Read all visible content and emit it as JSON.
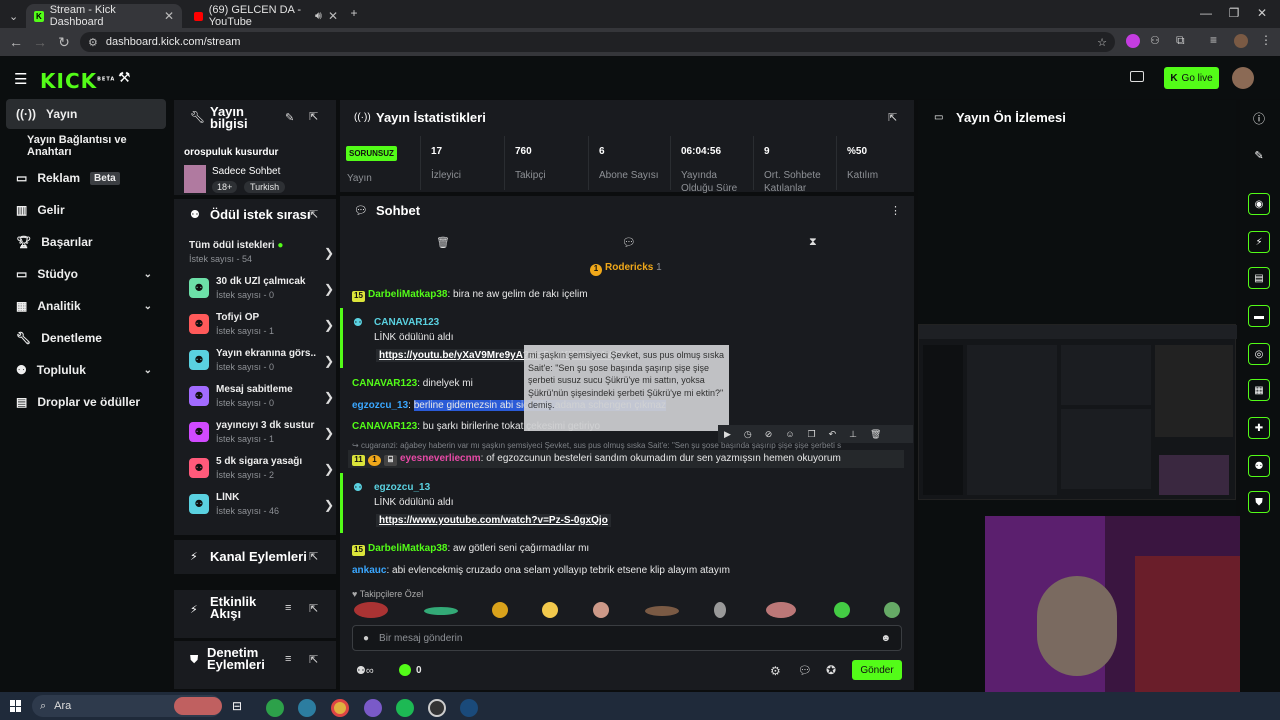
{
  "browser": {
    "tabs": [
      {
        "title": "Stream - Kick Dashboard"
      },
      {
        "title": "(69) GELCEN DA - YouTube"
      }
    ],
    "url": "dashboard.kick.com/stream"
  },
  "header": {
    "logo": "KICK",
    "logo_sup": "BETA",
    "go_live": "Go live"
  },
  "nav": {
    "items": [
      {
        "label": "Yayın"
      },
      {
        "label": "Yayın Bağlantısı ve Anahtarı"
      },
      {
        "label": "Reklam",
        "badge": "Beta"
      },
      {
        "label": "Gelir"
      },
      {
        "label": "Başarılar"
      },
      {
        "label": "Stüdyo"
      },
      {
        "label": "Analitik"
      },
      {
        "label": "Denetleme"
      },
      {
        "label": "Topluluk"
      },
      {
        "label": "Droplar ve ödüller"
      }
    ]
  },
  "stream_info": {
    "title": "Yayın bilgisi",
    "stream_title": "orospuluk kusurdur",
    "category": "Sadece Sohbet",
    "tags": [
      "18+",
      "Turkish"
    ]
  },
  "rewards": {
    "title": "Ödül istek sırası",
    "all": "Tüm ödül istekleri",
    "all_sub": "İstek sayısı - 54",
    "items": [
      {
        "title": "30 dk UZİ çalmıcak",
        "sub": "İstek sayısı - 0",
        "color": "#6de0a8"
      },
      {
        "title": "Tofiyi ÖP",
        "sub": "İstek sayısı - 1",
        "color": "#ff5a5a"
      },
      {
        "title": "Yayın ekranına görs...",
        "sub": "İstek sayısı - 0",
        "color": "#5ad1e0"
      },
      {
        "title": "Mesaj sabitleme",
        "sub": "İstek sayısı - 0",
        "color": "#a26bff"
      },
      {
        "title": "yayıncıyı 3 dk sustur",
        "sub": "İstek sayısı - 1",
        "color": "#d14aff"
      },
      {
        "title": "5 dk sigara yasağı",
        "sub": "İstek sayısı - 2",
        "color": "#ff5a7a"
      },
      {
        "title": "LİNK",
        "sub": "İstek sayısı - 46",
        "color": "#5ad1e0"
      }
    ]
  },
  "side_panels": {
    "channel_actions": "Kanal Eylemleri",
    "activity_feed": "Etkinlik Akışı",
    "mod_actions": "Denetim Eylemleri"
  },
  "stats": {
    "title": "Yayın İstatistikleri",
    "status": "SORUNSUZ",
    "status_label": "Yayın",
    "items": [
      {
        "value": "17",
        "label": "İzleyici"
      },
      {
        "value": "760",
        "label": "Takipçi"
      },
      {
        "value": "6",
        "label": "Abone Sayısı"
      },
      {
        "value": "06:04:56",
        "label": "Yayında Olduğu Süre"
      },
      {
        "value": "9",
        "label": "Ort. Sohbete Katılanlar"
      },
      {
        "value": "%50",
        "label": "Katılım"
      }
    ]
  },
  "chat": {
    "title": "Sohbet",
    "top_user": "Rodericks",
    "top_count": "1",
    "messages": {
      "m1_badge": "15",
      "m1_user": "DarbeliMatkap38",
      "m1_text": "bira ne aw gelim de rakı içelim",
      "r1_user": "CANAVAR123",
      "r1_action": "LİNK ödülünü aldı",
      "r1_link": "https://youtu.be/yXaV9Mre9yA?si=5guKYX5r5eWIPffd",
      "m2_user": "CANAVAR123",
      "m2_text": "dinelyek mi",
      "m3_user": "egzozcu_13",
      "m3_text": "berline gidemezsin abi sicil olur adama schengen çıkmaz",
      "m4_user": "CANAVAR123",
      "m4_text": "bu şarkı birilerine tokat çekesimi getiriyo",
      "reply_text": "cugaranzi: ağabey haberin var mı şaşkın şemsiyeci Şevket, sus pus olmuş sıska Sait'e: \"Sen şu şose başında şaşırıp şişe şişe şerbeti s",
      "m5_badge": "11",
      "m5_user": "eyesneverliecnm",
      "m5_text": "of egzozcunun besteleri sandım okumadım dur sen yazmışsın hemen okuyorum",
      "r2_user": "egzozcu_13",
      "r2_action": "LİNK ödülünü aldı",
      "r2_link": "https://www.youtube.com/watch?v=Pz-S-0gxQjo",
      "m6_badge": "15",
      "m6_user": "DarbeliMatkap38",
      "m6_text": "aw götleri seni çağırmadılar mı",
      "m7_user": "ankauc",
      "m7_text": "abi evlencekmiş cruzado ona selam yollayıp tebrik etsene klip alayım atayım"
    },
    "tooltip": "mi şaşkın şemsiyeci Şevket, sus pus olmuş sıska Sait'e: \"Sen şu şose başında şaşırıp şişe şişe şerbeti susuz sucu Şükrü'ye mi sattın, yoksa Şükrü'nün şişesindeki şerbeti Şükrü'ye mi ektin?\" demiş.",
    "emotes_label": "Takipçilere Özel",
    "input_placeholder": "Bir mesaj gönderin",
    "points": "0",
    "send": "Gönder"
  },
  "preview": {
    "title": "Yayın Ön İzlemesi"
  },
  "taskbar": {
    "search": "Ara"
  }
}
